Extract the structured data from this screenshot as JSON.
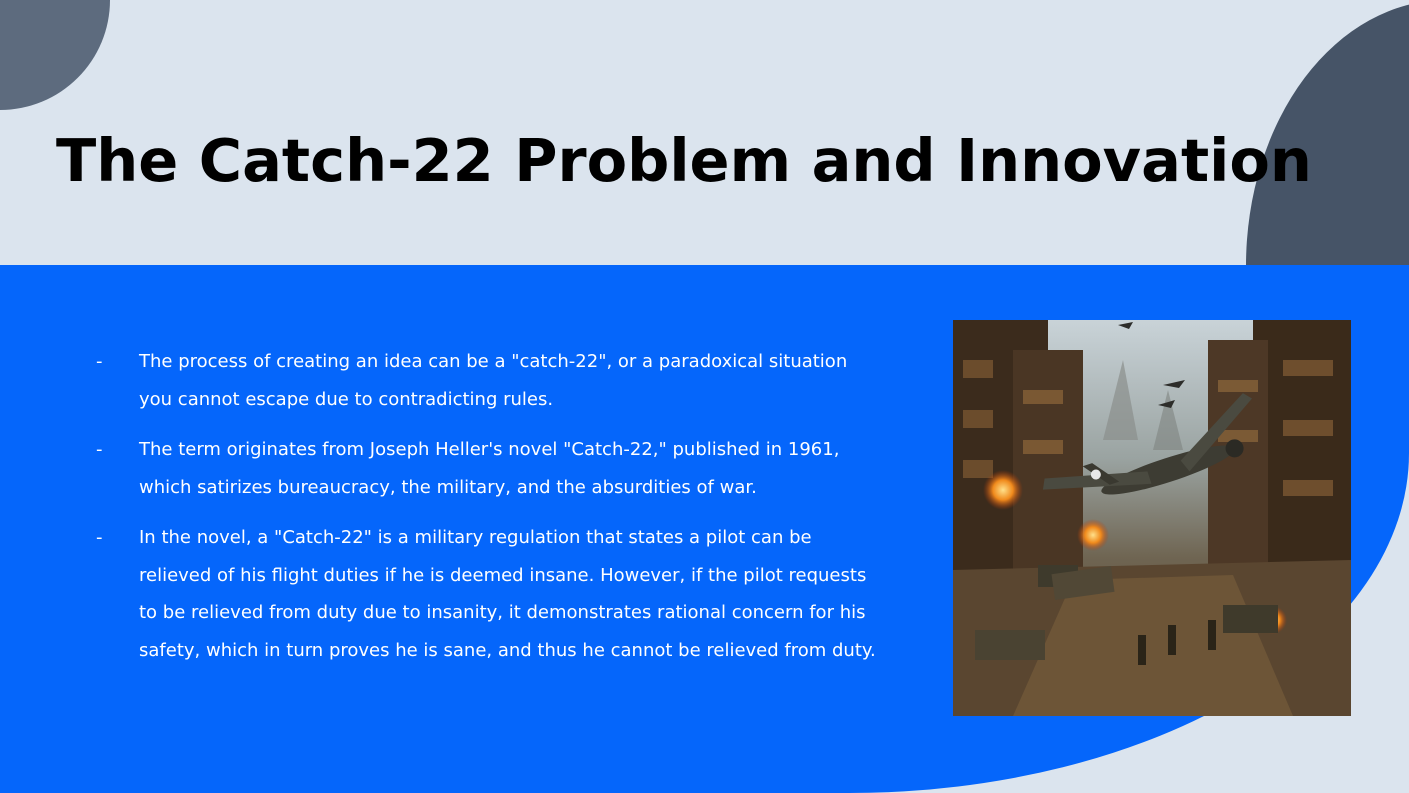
{
  "slide": {
    "title": "The Catch-22 Problem and Innovation",
    "bullet_marker": "-",
    "bullets": [
      "The process of creating an idea can be a \"catch-22\",  or a paradoxical situation you cannot escape due to contradicting rules.",
      "The term originates from Joseph Heller's novel \"Catch-22,\"  published in 1961, which satirizes bureaucracy, the military, and the absurdities of war.",
      "In the novel, a \"Catch-22\"  is a military regulation that states a pilot can be relieved of his flight duties if he is deemed insane. However, if the pilot requests to be relieved from duty due to insanity, it demonstrates rational concern for his safety, which in turn proves he is sane, and thus he cannot be relieved from duty."
    ]
  },
  "colors": {
    "background": "#dbe4ee",
    "panel_blue": "#0566fb",
    "corner_top_left": "#5d6b7e",
    "corner_top_right": "#465467",
    "title_text": "#000000",
    "body_text": "#ffffff"
  },
  "image": {
    "description_icon": "war-scene-illustration"
  }
}
